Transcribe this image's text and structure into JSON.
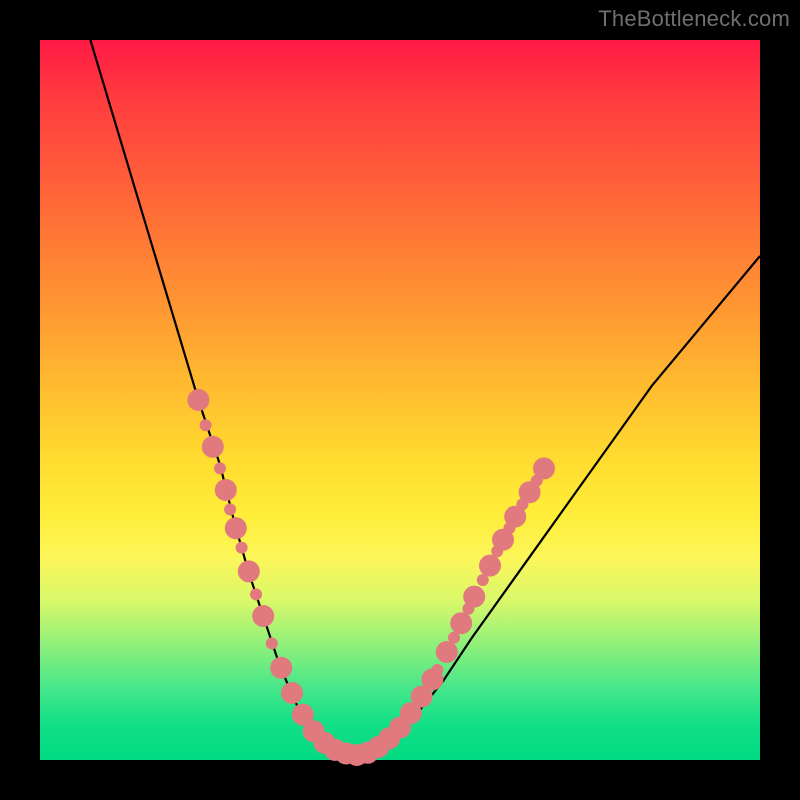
{
  "watermark": "TheBottleneck.com",
  "chart_data": {
    "type": "line",
    "title": "",
    "xlabel": "",
    "ylabel": "",
    "xlim": [
      0,
      100
    ],
    "ylim": [
      0,
      100
    ],
    "grid": false,
    "series": [
      {
        "name": "bottleneck-curve",
        "x": [
          7,
          10,
          13,
          16,
          19,
          22,
          25,
          27,
          29,
          31,
          33,
          35,
          37,
          40,
          44,
          48,
          52,
          56,
          60,
          65,
          70,
          75,
          80,
          85,
          90,
          95,
          100
        ],
        "y": [
          100,
          90,
          80,
          70,
          60,
          50,
          41,
          33,
          26,
          20,
          14,
          9,
          5,
          2,
          0.7,
          2.5,
          6,
          11,
          17,
          24,
          31,
          38,
          45,
          52,
          58,
          64,
          70
        ]
      }
    ],
    "markers": {
      "name": "highlight-dots",
      "color": "#e07a7e",
      "radius_major": 11,
      "radius_minor": 6,
      "points": [
        {
          "x": 22.0,
          "y": 50.0,
          "r": "major"
        },
        {
          "x": 23.0,
          "y": 46.5,
          "r": "minor"
        },
        {
          "x": 24.0,
          "y": 43.5,
          "r": "major"
        },
        {
          "x": 25.0,
          "y": 40.5,
          "r": "minor"
        },
        {
          "x": 25.8,
          "y": 37.5,
          "r": "major"
        },
        {
          "x": 26.4,
          "y": 34.8,
          "r": "minor"
        },
        {
          "x": 27.2,
          "y": 32.2,
          "r": "major"
        },
        {
          "x": 28.0,
          "y": 29.5,
          "r": "minor"
        },
        {
          "x": 29.0,
          "y": 26.2,
          "r": "major"
        },
        {
          "x": 30.0,
          "y": 23.0,
          "r": "minor"
        },
        {
          "x": 31.0,
          "y": 20.0,
          "r": "major"
        },
        {
          "x": 32.2,
          "y": 16.2,
          "r": "minor"
        },
        {
          "x": 33.5,
          "y": 12.8,
          "r": "major"
        },
        {
          "x": 35.0,
          "y": 9.3,
          "r": "major"
        },
        {
          "x": 36.5,
          "y": 6.3,
          "r": "major"
        },
        {
          "x": 38.0,
          "y": 4.0,
          "r": "major"
        },
        {
          "x": 39.5,
          "y": 2.4,
          "r": "major"
        },
        {
          "x": 41.0,
          "y": 1.4,
          "r": "major"
        },
        {
          "x": 42.5,
          "y": 0.9,
          "r": "major"
        },
        {
          "x": 44.0,
          "y": 0.7,
          "r": "major"
        },
        {
          "x": 45.5,
          "y": 1.0,
          "r": "major"
        },
        {
          "x": 47.0,
          "y": 1.8,
          "r": "major"
        },
        {
          "x": 48.5,
          "y": 3.0,
          "r": "major"
        },
        {
          "x": 50.0,
          "y": 4.5,
          "r": "major"
        },
        {
          "x": 51.5,
          "y": 6.5,
          "r": "major"
        },
        {
          "x": 53.0,
          "y": 8.8,
          "r": "major"
        },
        {
          "x": 54.5,
          "y": 11.2,
          "r": "major"
        },
        {
          "x": 55.2,
          "y": 12.5,
          "r": "minor"
        },
        {
          "x": 56.5,
          "y": 15.0,
          "r": "major"
        },
        {
          "x": 57.5,
          "y": 17.0,
          "r": "minor"
        },
        {
          "x": 58.5,
          "y": 19.0,
          "r": "major"
        },
        {
          "x": 59.5,
          "y": 21.0,
          "r": "minor"
        },
        {
          "x": 60.3,
          "y": 22.7,
          "r": "major"
        },
        {
          "x": 61.5,
          "y": 25.0,
          "r": "minor"
        },
        {
          "x": 62.5,
          "y": 27.0,
          "r": "major"
        },
        {
          "x": 63.5,
          "y": 29.0,
          "r": "minor"
        },
        {
          "x": 64.3,
          "y": 30.6,
          "r": "major"
        },
        {
          "x": 65.2,
          "y": 32.2,
          "r": "minor"
        },
        {
          "x": 66.0,
          "y": 33.8,
          "r": "major"
        },
        {
          "x": 67.0,
          "y": 35.5,
          "r": "minor"
        },
        {
          "x": 68.0,
          "y": 37.2,
          "r": "major"
        },
        {
          "x": 69.0,
          "y": 38.8,
          "r": "minor"
        },
        {
          "x": 70.0,
          "y": 40.5,
          "r": "major"
        }
      ]
    }
  }
}
